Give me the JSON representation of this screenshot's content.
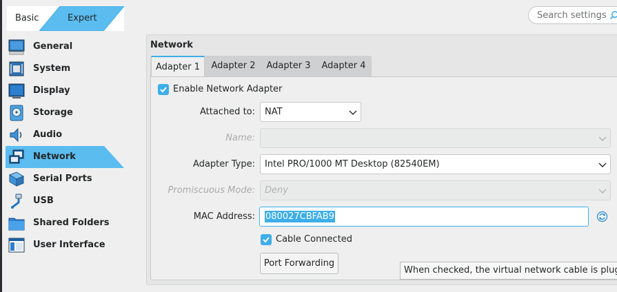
{
  "mode": {
    "basic_label": "Basic",
    "expert_label": "Expert",
    "active": "expert"
  },
  "search": {
    "placeholder": "Search settings",
    "icon": "search-icon"
  },
  "sidebar": {
    "items": [
      {
        "label": "General",
        "icon": "general-icon"
      },
      {
        "label": "System",
        "icon": "system-icon"
      },
      {
        "label": "Display",
        "icon": "display-icon"
      },
      {
        "label": "Storage",
        "icon": "storage-icon"
      },
      {
        "label": "Audio",
        "icon": "audio-icon"
      },
      {
        "label": "Network",
        "icon": "network-icon",
        "active": true
      },
      {
        "label": "Serial Ports",
        "icon": "serial-ports-icon"
      },
      {
        "label": "USB",
        "icon": "usb-icon"
      },
      {
        "label": "Shared Folders",
        "icon": "shared-folders-icon"
      },
      {
        "label": "User Interface",
        "icon": "user-interface-icon"
      }
    ]
  },
  "network": {
    "group_title": "Network",
    "tabs": [
      {
        "label": "Adapter 1",
        "active": true
      },
      {
        "label": "Adapter 2"
      },
      {
        "label": "Adapter 3"
      },
      {
        "label": "Adapter 4"
      }
    ],
    "enable_label": "Enable Network Adapter",
    "enable_checked": true,
    "attached_label": "Attached to:",
    "attached_value": "NAT",
    "name_label": "Name:",
    "name_value": "",
    "adapter_type_label": "Adapter Type:",
    "adapter_type_value": "Intel PRO/1000 MT Desktop (82540EM)",
    "promiscuous_label": "Promiscuous Mode:",
    "promiscuous_value": "Deny",
    "mac_label": "MAC Address:",
    "mac_value": "080027CBFAB9",
    "cable_label": "Cable Connected",
    "cable_checked": true,
    "port_forwarding_label": "Port Forwarding",
    "tooltip": "When checked, the virtual network cable is plugged"
  },
  "colors": {
    "accent": "#3daee9",
    "sidebar_highlight": "#5bbcf0"
  }
}
